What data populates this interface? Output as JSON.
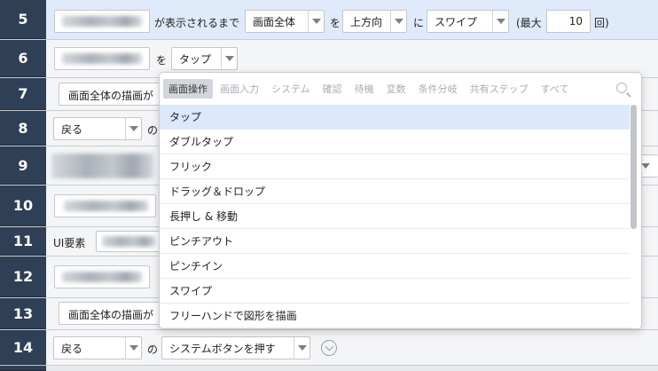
{
  "rows": [
    {
      "num": "5"
    },
    {
      "num": "6"
    },
    {
      "num": "7"
    },
    {
      "num": "8"
    },
    {
      "num": "9"
    },
    {
      "num": "10"
    },
    {
      "num": "11"
    },
    {
      "num": "12"
    },
    {
      "num": "13"
    },
    {
      "num": "14"
    }
  ],
  "row5": {
    "until_text": "が表示されるまで",
    "target": "画面全体",
    "particle_wo": "を",
    "direction": "上方向",
    "particle_ni": "に",
    "action": "スワイプ",
    "max_open": "(最大",
    "max_value": "10",
    "max_close": "回)"
  },
  "row6": {
    "particle_wo": "を",
    "action": "タップ"
  },
  "row7": {
    "text": "画面全体の描画が"
  },
  "row8": {
    "select": "戻る",
    "particle": "の"
  },
  "row11": {
    "label": "UI要素"
  },
  "row13": {
    "text": "画面全体の描画が"
  },
  "row14": {
    "select": "戻る",
    "particle": "の",
    "action": "システムボタンを押す"
  },
  "popup": {
    "tabs": [
      "画面操作",
      "画面入力",
      "システム",
      "確認",
      "待機",
      "変数",
      "条件分岐",
      "共有ステップ",
      "すべて"
    ],
    "options": [
      "タップ",
      "ダブルタップ",
      "フリック",
      "ドラッグ＆ドロップ",
      "長押し & 移動",
      "ピンチアウト",
      "ピンチイン",
      "スワイプ",
      "フリーハンドで図形を描画"
    ]
  },
  "colors": {
    "num_bg": "#2f3f55",
    "selected_row": "#dfeafb",
    "highlight": "#dce8fb"
  }
}
